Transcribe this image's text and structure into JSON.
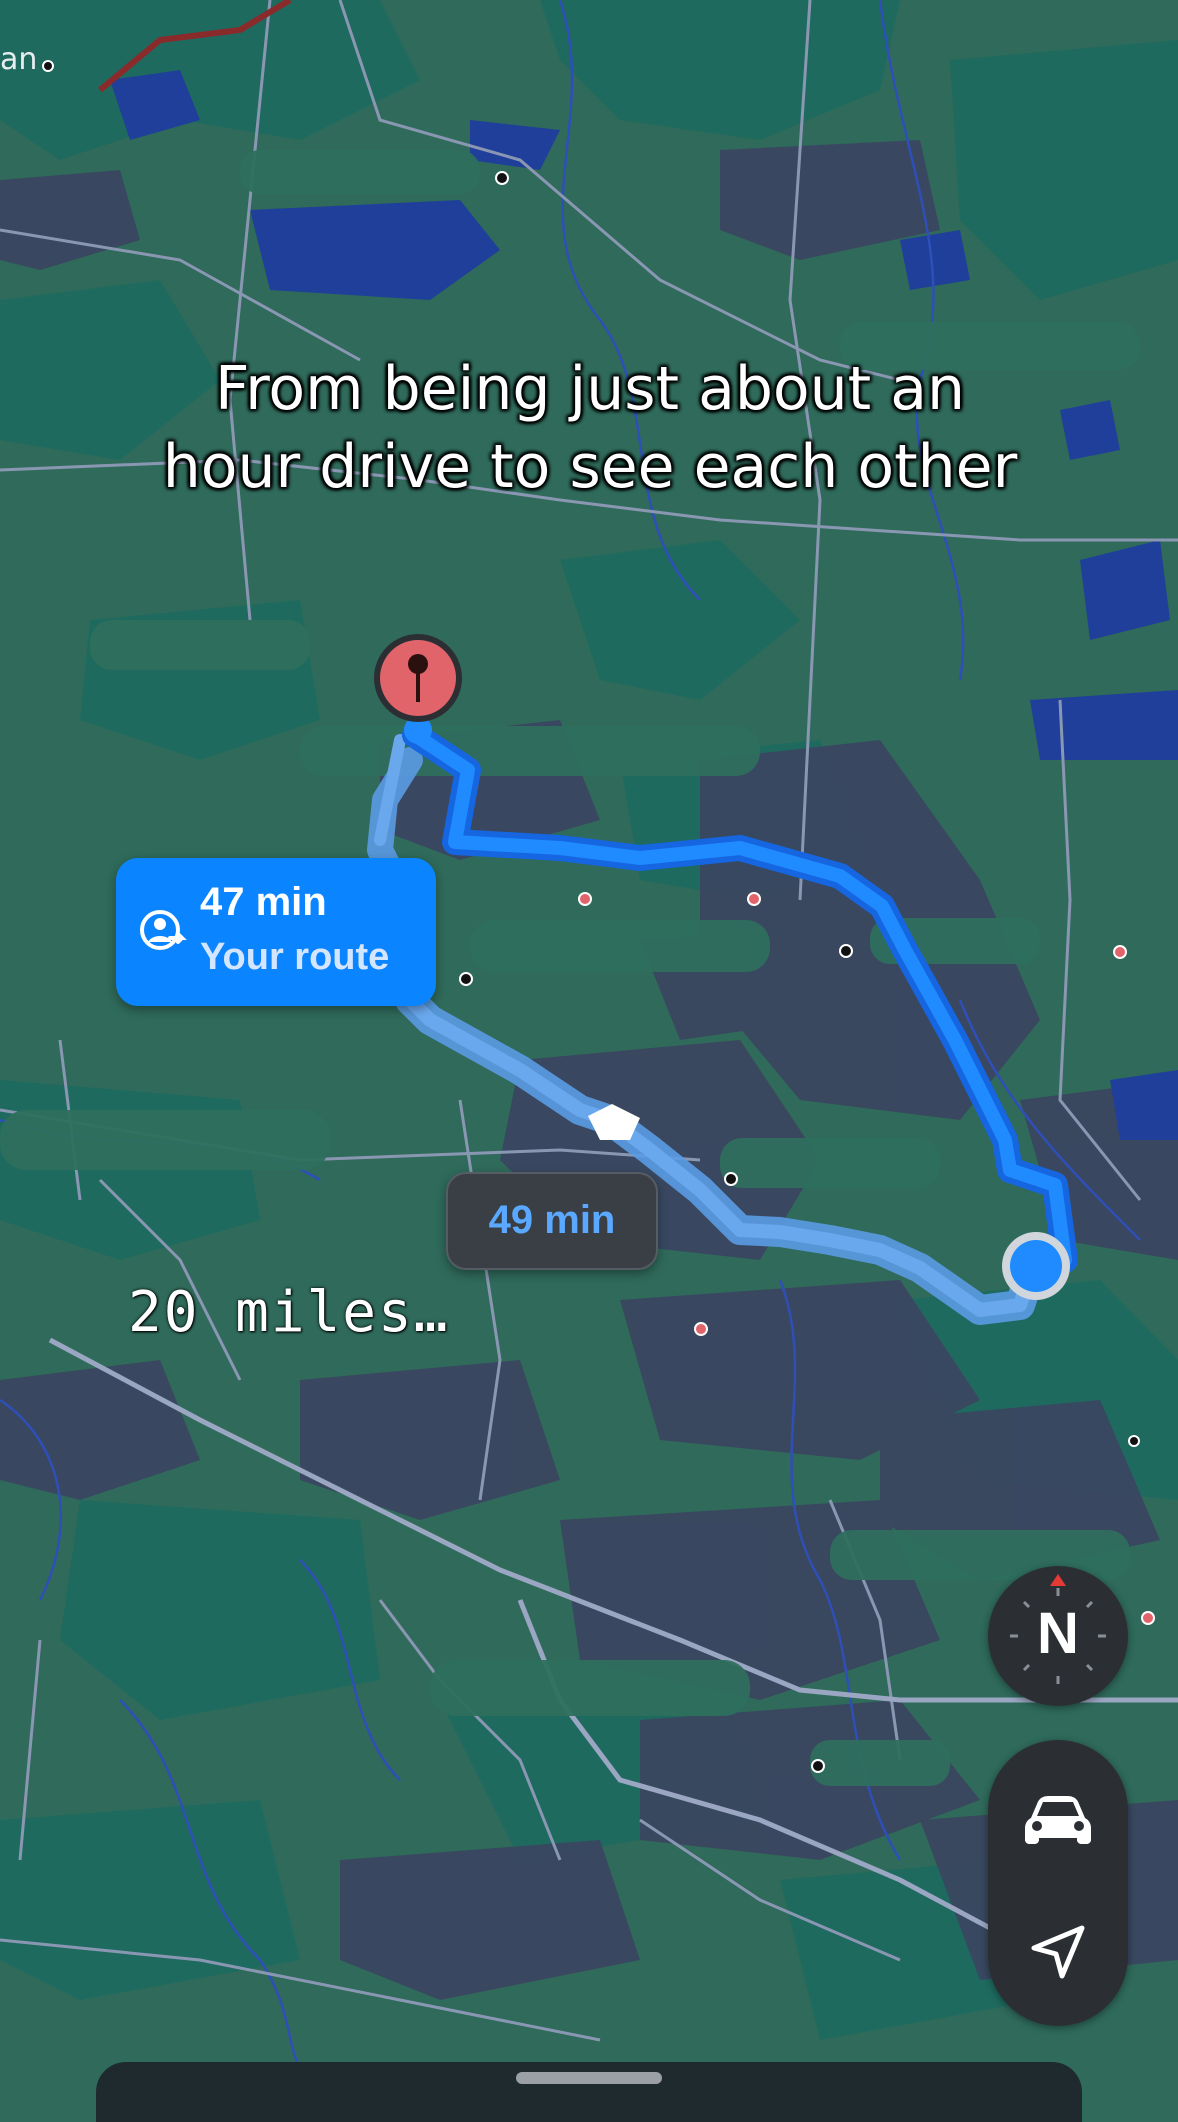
{
  "map": {
    "place_label": "an",
    "colors": {
      "land": "#2f6a5a",
      "forest": "#1f6a5e",
      "urban": "#3b4560",
      "water": "#1f3f9a",
      "road": "#8a97b3",
      "highway": "#8b2a2a",
      "route_primary": "#1a80ff",
      "route_alt": "#5b9be4"
    }
  },
  "caption": {
    "text": "From being just about an hour drive to see each other"
  },
  "typed_text": "20 miles…",
  "route_card": {
    "time": "47 min",
    "label": "Your route",
    "icon": "route-person-icon",
    "color": "#0a84ff"
  },
  "alt_route": {
    "time": "49 min"
  },
  "destination": {
    "icon": "destination-pin-icon",
    "color": "#e0646a"
  },
  "origin": {
    "icon": "current-location-dot",
    "color": "#0a84ff"
  },
  "compass": {
    "label": "N",
    "icon": "compass-icon"
  },
  "controls": {
    "drive_icon": "car-icon",
    "locate_icon": "location-arrow-icon"
  }
}
